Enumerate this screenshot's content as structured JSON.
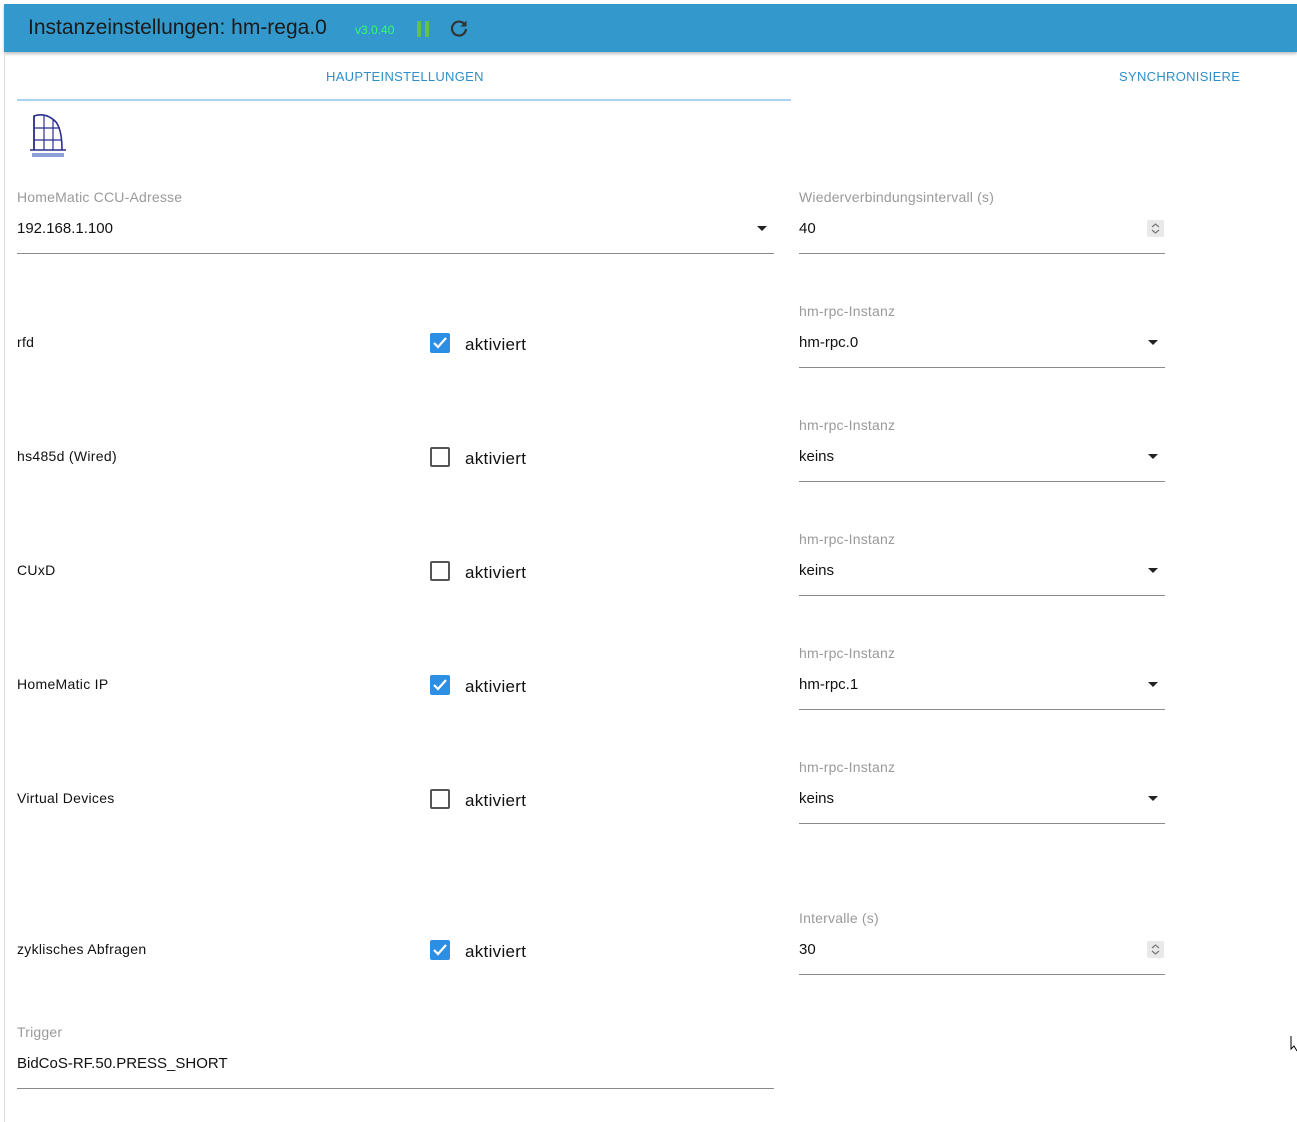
{
  "header": {
    "title": "Instanzeinstellungen: hm-rega.0",
    "version": "v3.0.40",
    "bg_color": "#3399cc",
    "icons": [
      "pause-icon",
      "reload-icon"
    ]
  },
  "tabs": [
    {
      "label": "HAUPTEINSTELLUNGEN",
      "active": true
    },
    {
      "label": "SYNCHRONISIERE",
      "active": false
    }
  ],
  "ccu": {
    "label": "HomeMatic CCU-Adresse",
    "value": "192.168.1.100"
  },
  "reconnect": {
    "label": "Wiederverbindungsintervall (s)",
    "value": "40"
  },
  "rows": [
    {
      "label": "rfd",
      "checked": true,
      "check_label": "aktiviert",
      "select_label": "hm-rpc-Instanz",
      "select_value": "hm-rpc.0"
    },
    {
      "label": "hs485d (Wired)",
      "checked": false,
      "check_label": "aktiviert",
      "select_label": "hm-rpc-Instanz",
      "select_value": "keins"
    },
    {
      "label": "CUxD",
      "checked": false,
      "check_label": "aktiviert",
      "select_label": "hm-rpc-Instanz",
      "select_value": "keins"
    },
    {
      "label": "HomeMatic IP",
      "checked": true,
      "check_label": "aktiviert",
      "select_label": "hm-rpc-Instanz",
      "select_value": "hm-rpc.1"
    },
    {
      "label": "Virtual Devices",
      "checked": false,
      "check_label": "aktiviert",
      "select_label": "hm-rpc-Instanz",
      "select_value": "keins"
    }
  ],
  "polling": {
    "label": "zyklisches Abfragen",
    "checked": true,
    "check_label": "aktiviert",
    "interval_label": "Intervalle (s)",
    "interval_value": "30"
  },
  "trigger": {
    "label": "Trigger",
    "value": "BidCoS-RF.50.PRESS_SHORT"
  },
  "colors": {
    "accent": "#2e8fc8",
    "checkbox_on": "#2d8fe3",
    "version_text": "#33ff66",
    "pause_icon": "#63c243"
  }
}
